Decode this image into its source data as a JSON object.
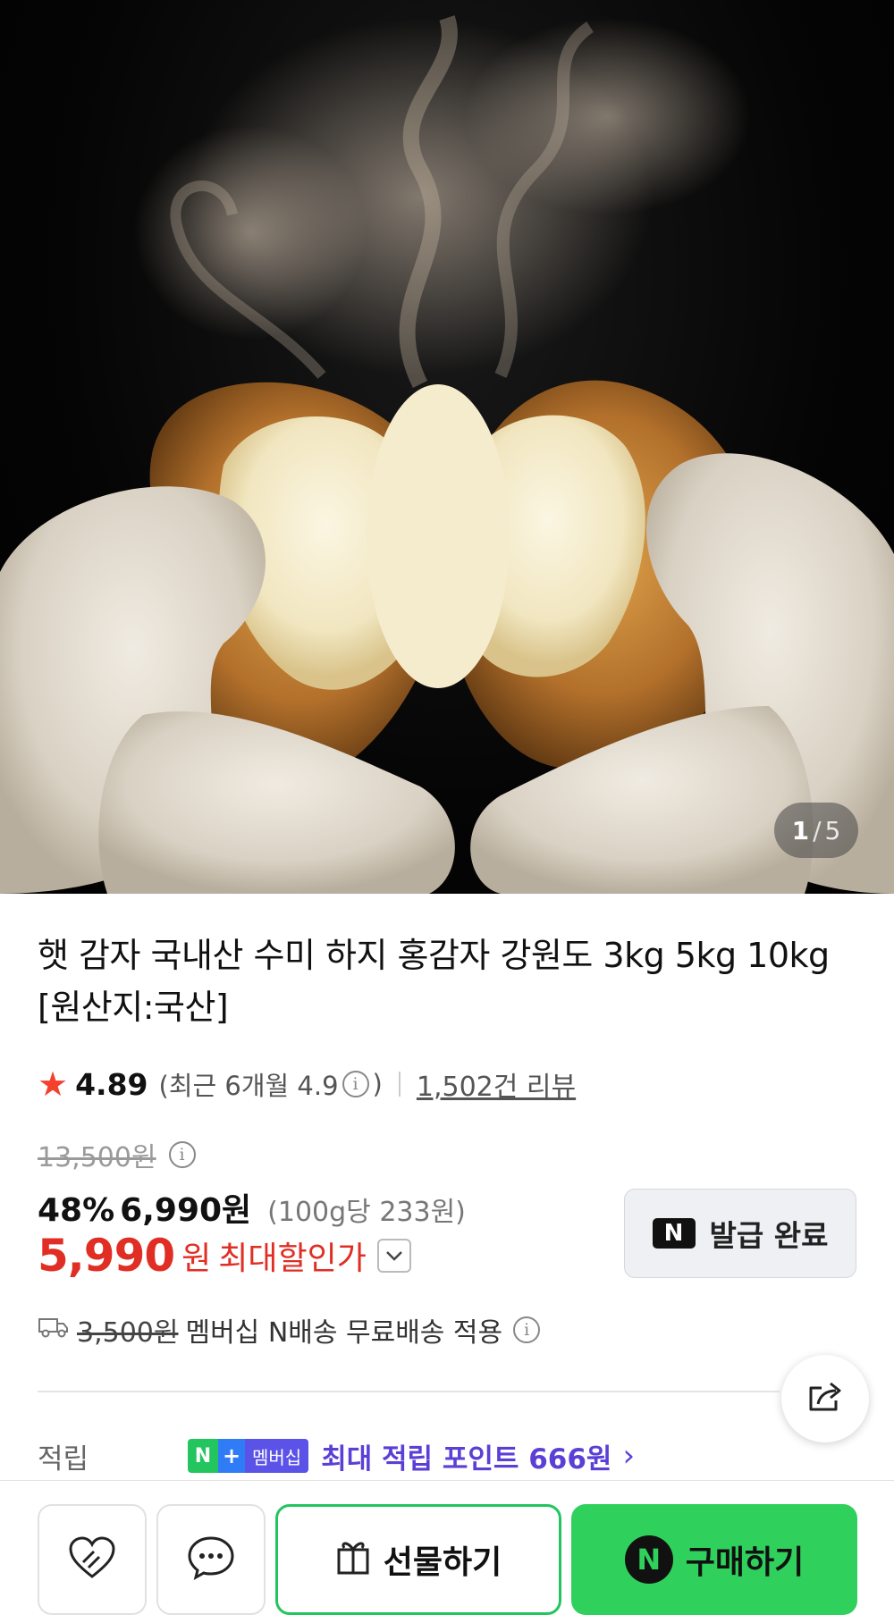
{
  "gallery": {
    "current": "1",
    "separator": "/",
    "total": "5"
  },
  "product": {
    "title": "햇 감자 국내산 수미 하지 홍감자 강원도 3kg 5kg 10kg [원산지:국산]",
    "rating": "4.89",
    "recent_prefix": "(최근 6개월 4.9",
    "recent_suffix": ")",
    "review_count": "1,502건 리뷰"
  },
  "price": {
    "original": "13,500원",
    "discount_rate": "48%",
    "sale_price": "6,990원",
    "unit_price": "(100g당 233원)",
    "max_discount_price": "5,990",
    "max_discount_currency": "원",
    "max_discount_label": "최대할인가"
  },
  "coupon": {
    "badge": "N",
    "label": "발급 완료"
  },
  "shipping": {
    "original_fee": "3,500원",
    "text": "멤버십 N배송 무료배송 적용"
  },
  "points": {
    "label": "적립",
    "badge_n": "N",
    "badge_plus": "+",
    "badge_membership": "멤버십",
    "text": "최대 적립 포인트 666원",
    "chevron": "›"
  },
  "bottom_bar": {
    "gift_label": "선물하기",
    "buy_badge": "N",
    "buy_label": "구매하기"
  },
  "colors": {
    "accent_red": "#e02e24",
    "star": "#f4412e",
    "naver_green": "#2fd15c",
    "point_purple": "#5b3fd6"
  }
}
